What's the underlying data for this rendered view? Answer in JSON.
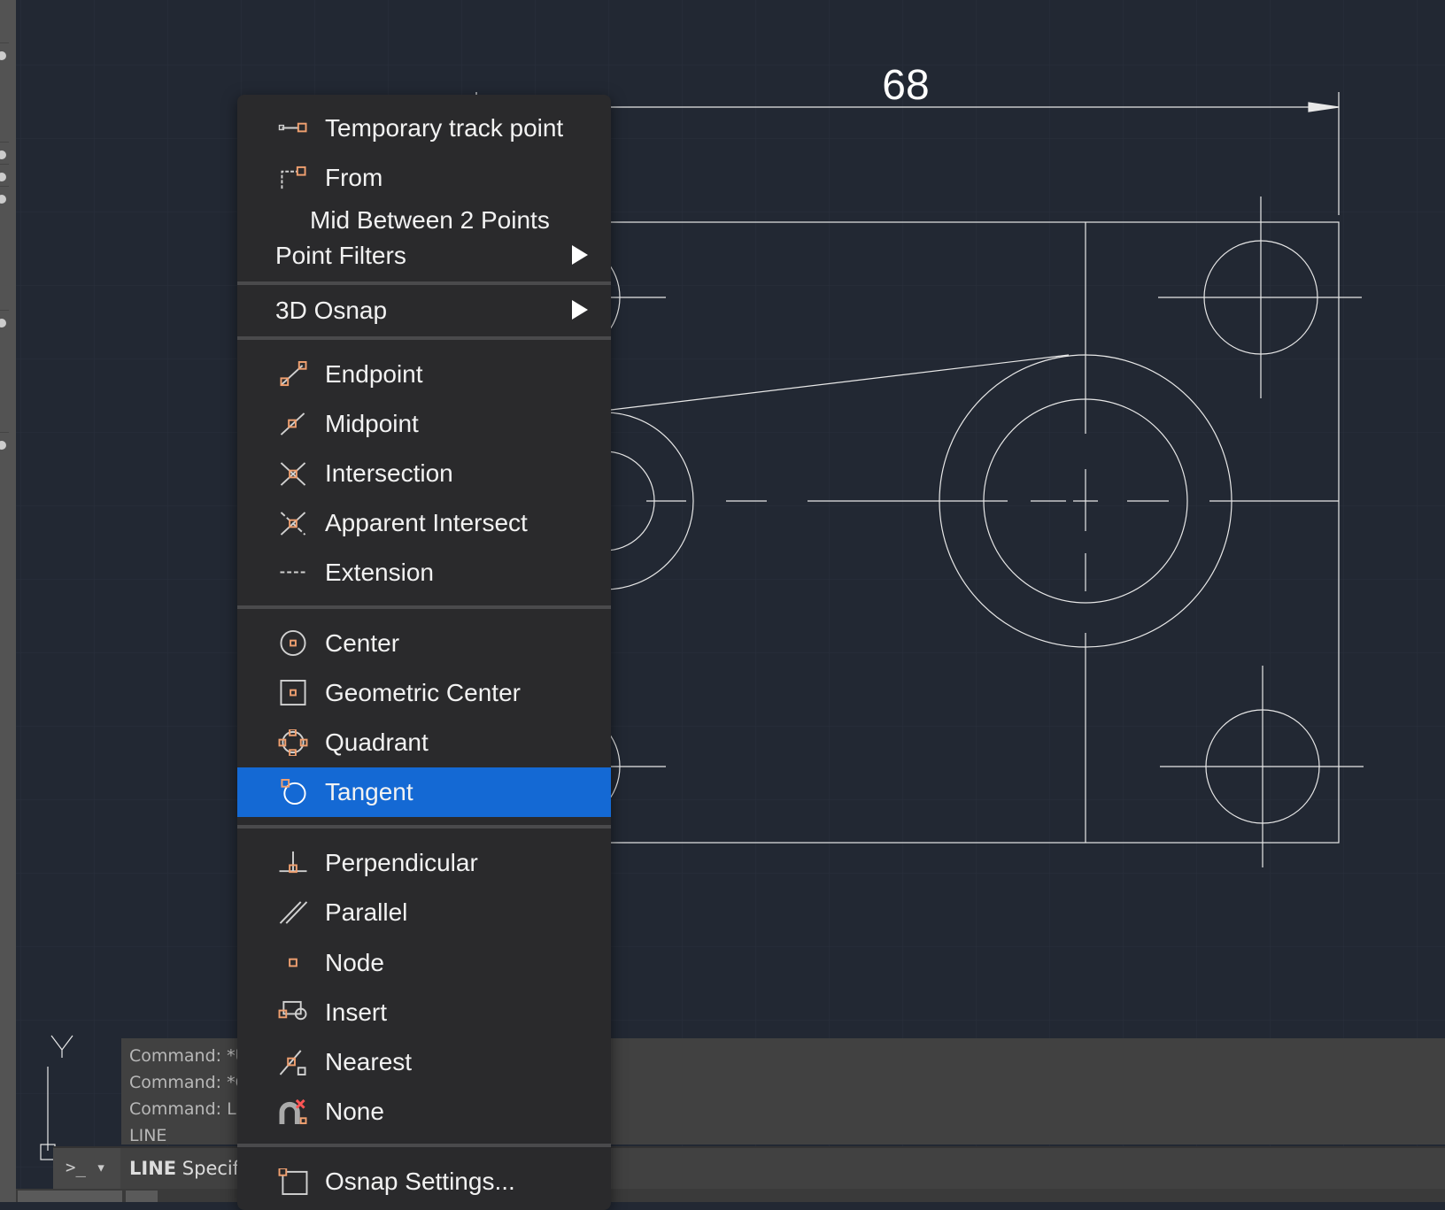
{
  "drawing": {
    "dimension_label": "68",
    "ucs_y_label": "Y"
  },
  "menu": {
    "items": [
      {
        "label": "Temporary track point",
        "icon": "temporary-track-point-icon"
      },
      {
        "label": "From",
        "icon": "from-icon"
      },
      {
        "label": "Mid Between 2 Points"
      },
      {
        "label": "Point Filters",
        "submenu": true
      },
      {
        "label": "3D Osnap",
        "submenu": true
      },
      {
        "label": "Endpoint",
        "icon": "endpoint-icon"
      },
      {
        "label": "Midpoint",
        "icon": "midpoint-icon"
      },
      {
        "label": "Intersection",
        "icon": "intersection-icon"
      },
      {
        "label": "Apparent Intersect",
        "icon": "apparent-intersect-icon"
      },
      {
        "label": "Extension",
        "icon": "extension-icon"
      },
      {
        "label": "Center",
        "icon": "center-icon"
      },
      {
        "label": "Geometric Center",
        "icon": "geometric-center-icon"
      },
      {
        "label": "Quadrant",
        "icon": "quadrant-icon"
      },
      {
        "label": "Tangent",
        "icon": "tangent-icon",
        "selected": true
      },
      {
        "label": "Perpendicular",
        "icon": "perpendicular-icon"
      },
      {
        "label": "Parallel",
        "icon": "parallel-icon"
      },
      {
        "label": "Node",
        "icon": "node-icon"
      },
      {
        "label": "Insert",
        "icon": "insert-icon"
      },
      {
        "label": "Nearest",
        "icon": "nearest-icon"
      },
      {
        "label": "None",
        "icon": "none-magnet-icon"
      },
      {
        "label": "Osnap Settings...",
        "icon": "osnap-settings-icon"
      }
    ]
  },
  "command": {
    "history": [
      "Command: *U",
      "Command: *C",
      "Command: L",
      "LINE"
    ],
    "prompt_symbol": ">_",
    "current_bold": "LINE",
    "current_rest": " Specif"
  },
  "colors": {
    "accent": "#1469d4",
    "snap_marker": "#f0a070",
    "background": "#222833"
  }
}
